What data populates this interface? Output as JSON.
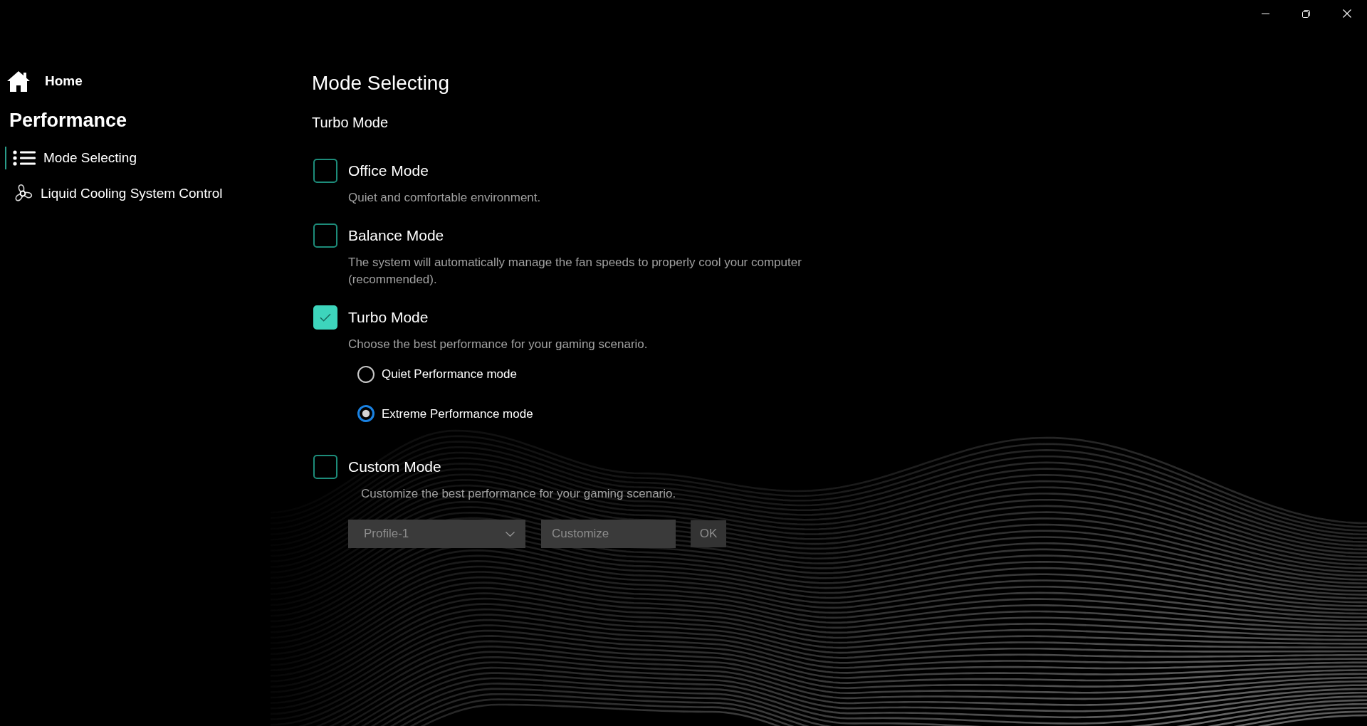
{
  "sidebar": {
    "home": {
      "label": "Home"
    },
    "section_title": "Performance",
    "items": [
      {
        "label": "Mode Selecting",
        "selected": true
      },
      {
        "label": "Liquid Cooling System Control",
        "selected": false
      }
    ]
  },
  "page": {
    "title": "Mode Selecting",
    "current_mode": "Turbo Mode"
  },
  "modes": [
    {
      "label": "Office Mode",
      "description": "Quiet and comfortable environment.",
      "checked": false
    },
    {
      "label": "Balance Mode",
      "description": "The system will automatically manage the fan speeds to properly cool your computer (recommended).",
      "checked": false
    },
    {
      "label": "Turbo Mode",
      "description": "Choose the best performance for your gaming scenario.",
      "checked": true,
      "options": [
        {
          "label": "Quiet Performance mode",
          "selected": false
        },
        {
          "label": "Extreme Performance mode",
          "selected": true
        }
      ]
    },
    {
      "label": "Custom Mode",
      "description": "Customize the best performance for your gaming scenario.",
      "checked": false,
      "profile_dropdown": {
        "value": "Profile-1"
      },
      "customize_field": {
        "placeholder": "Customize"
      },
      "ok_button": {
        "label": "OK"
      }
    }
  ]
}
